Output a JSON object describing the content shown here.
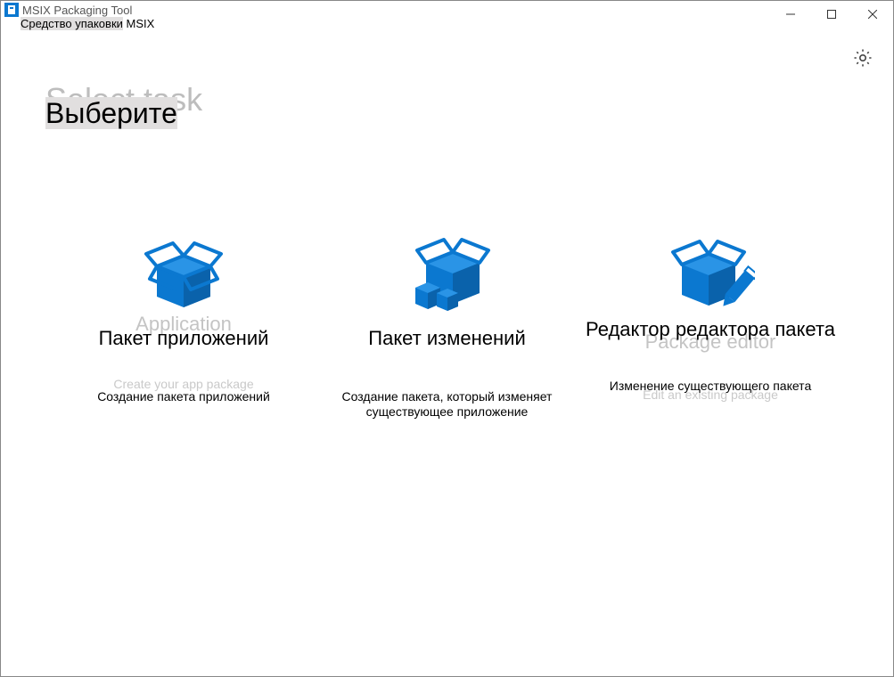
{
  "titlebar": {
    "app_title_en": "MSIX Packaging Tool",
    "app_title_ru_hl": "Средство упаковки",
    "app_title_ru_rest": " MSIX"
  },
  "window_controls": {
    "minimize": "—",
    "maximize": "☐",
    "close": "✕"
  },
  "header": {
    "heading_en": "Select task",
    "heading_ru_hl": "Выберите",
    "heading_ru_rest": ""
  },
  "cards": {
    "app_package": {
      "title_en": "Application",
      "title_ru": "Пакет приложений",
      "desc_en": "Create your app package",
      "desc_ru": "Создание пакета приложений"
    },
    "mod_package": {
      "title_en": "",
      "title_ru": "Пакет изменений",
      "desc_en": "",
      "desc_ru": "Создание пакета, который изменяет существующее приложение"
    },
    "pkg_editor": {
      "title_en": "Package editor",
      "title_ru": "Редактор редактора пакета",
      "desc_en": "Edit an existing package",
      "desc_ru": "Изменение существующего пакета"
    }
  }
}
